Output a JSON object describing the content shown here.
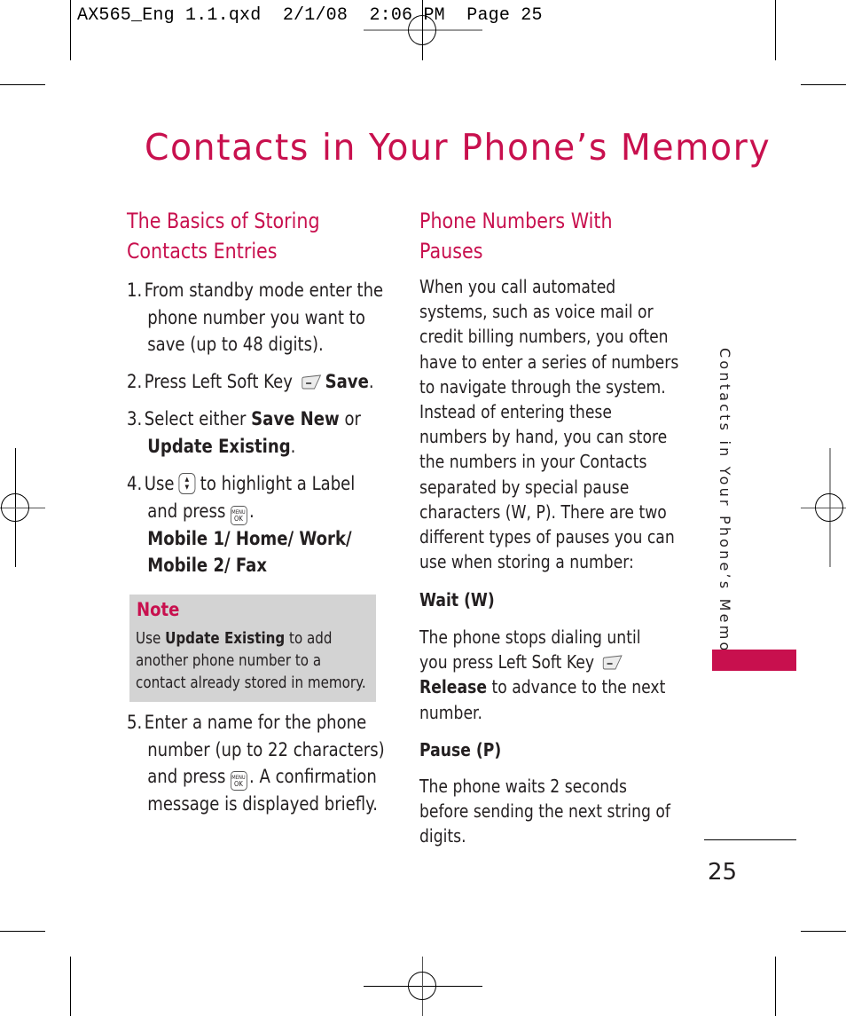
{
  "slug": "AX565_Eng 1.1.qxd  2/1/08  2:06 PM  Page 25",
  "title": "Contacts in Your Phone’s Memory",
  "left_column": {
    "heading_line1": "The Basics of Storing",
    "heading_line2": "Contacts Entries",
    "steps": [
      {
        "num": "1.",
        "lines": [
          "From standby mode enter the",
          "phone number you want to",
          "save (up to 48 digits)."
        ]
      },
      {
        "num": "2.",
        "text_before": "Press Left Soft Key",
        "icon": "left-soft-key-icon",
        "bold": "Save",
        "text_after": "."
      },
      {
        "num": "3.",
        "text_before": "Select either",
        "bold1": "Save New",
        "mid": "or",
        "bold2": "Update Existing",
        "text_after": "."
      },
      {
        "num": "4.",
        "text_before": "Use",
        "icon1": "navigation-key-icon",
        "text_mid": "to highlight a Label",
        "line2_before": "and press",
        "icon2": "menu-ok-key-icon",
        "line2_after": ".",
        "options_line1": "Mobile 1/ Home/ Work/",
        "options_line2": "Mobile 2/ Fax"
      },
      {
        "num": "5.",
        "line1": "Enter a name for the phone",
        "line2": "number (up to 22 characters)",
        "line3_before": "and press",
        "icon": "menu-ok-key-icon",
        "line3_after": ". A confirmation",
        "line4": "message is displayed briefly."
      }
    ],
    "note": {
      "title": "Note",
      "line1_before": "Use",
      "line1_bold": "Update Existing",
      "line1_after": "to add",
      "line2": "another phone number to a",
      "line3": "contact already stored in memory."
    }
  },
  "right_column": {
    "heading_line1": "Phone Numbers With",
    "heading_line2": "Pauses",
    "intro_lines": [
      "When you call automated",
      "systems, such as voice mail or",
      "credit billing numbers, you often",
      "have to enter a series of numbers",
      "to navigate through the system.",
      "Instead of entering these",
      "numbers by hand, you can store",
      "the numbers in your Contacts",
      "separated by special pause",
      "characters (W, P). There are two",
      "different types of pauses you can",
      "use when storing a number:"
    ],
    "wait": {
      "heading": "Wait (W)",
      "line1": "The phone stops dialing until",
      "line2": "you press Left Soft Key",
      "icon": "left-soft-key-icon",
      "line3_bold": "Release",
      "line3_after": "to advance to the next",
      "line4": "number."
    },
    "pause": {
      "heading": "Pause (P)",
      "lines": [
        "The phone waits 2 seconds",
        "before sending the next string of",
        "digits."
      ]
    }
  },
  "side_tab_label": "Contacts in Your Phone’s Memory",
  "page_number": "25",
  "colors": {
    "accent": "#c8104e",
    "note_bg": "#d3d3d3",
    "text": "#231f20"
  },
  "keys": {
    "menu_top": "MENU",
    "menu_bottom": "OK",
    "nav_up": "▲",
    "nav_down": "▼"
  }
}
